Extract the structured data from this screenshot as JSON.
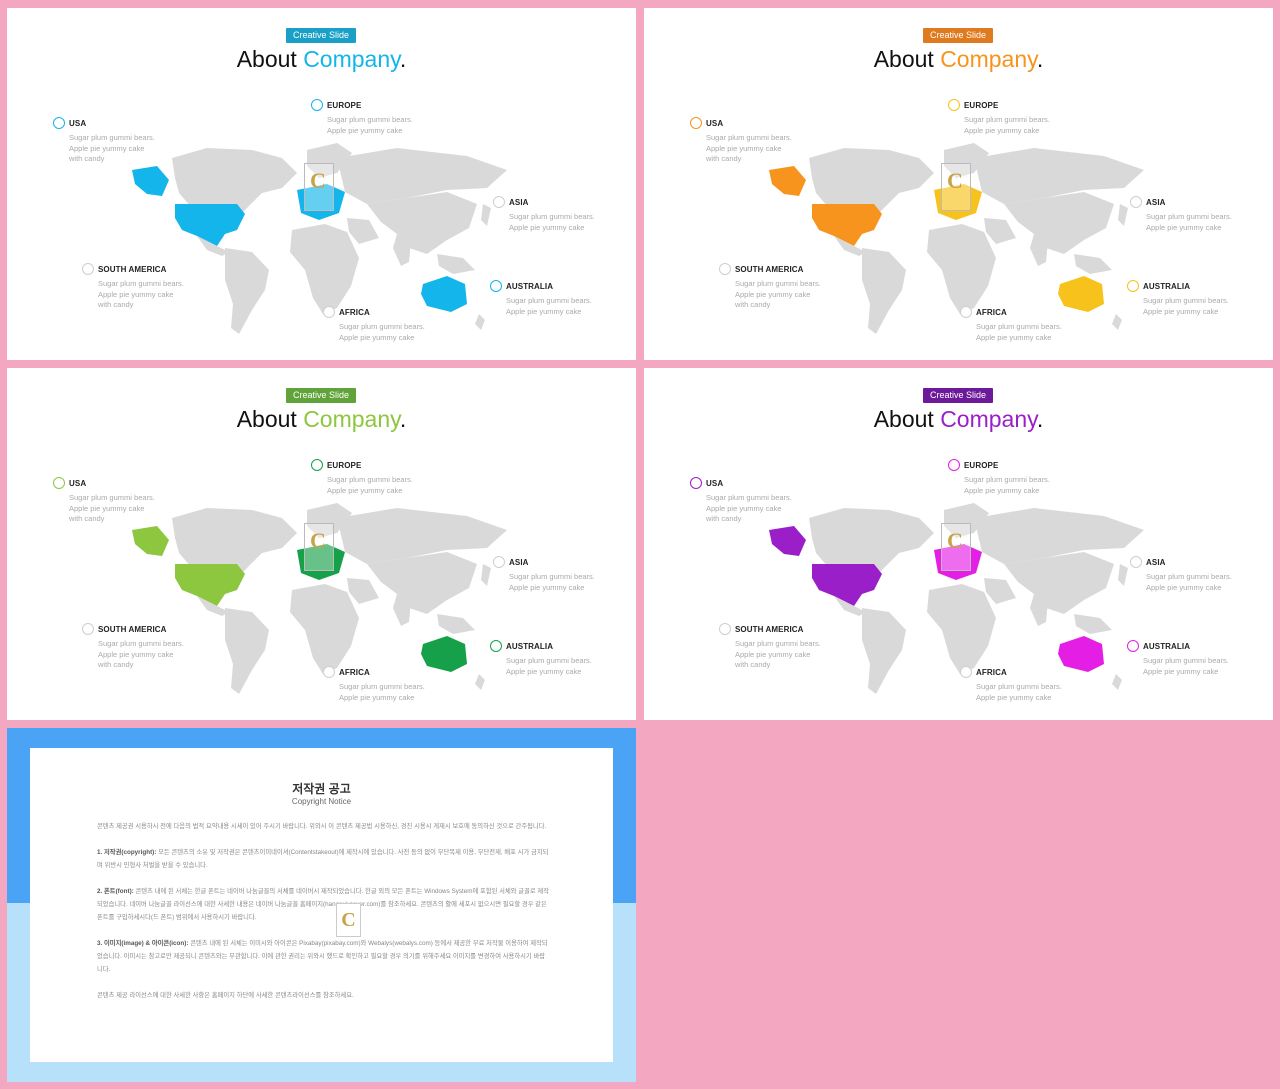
{
  "slides": [
    {
      "badge": "Creative Slide",
      "title_main": "About ",
      "title_accent": "Company",
      "title_end": ".",
      "accent": "#13b5ea",
      "badge_color": "#1aa0c6"
    },
    {
      "badge": "Creative Slide",
      "title_main": "About ",
      "title_accent": "Company",
      "title_end": ".",
      "accent": "#f7941d",
      "badge_color": "#e07a1f",
      "accent2": "#f7c21c"
    },
    {
      "badge": "Creative Slide",
      "title_main": "About ",
      "title_accent": "Company",
      "title_end": ".",
      "accent": "#8dc63f",
      "badge_color": "#5fa33a",
      "accent2": "#16a04a"
    },
    {
      "badge": "Creative Slide",
      "title_main": "About ",
      "title_accent": "Company",
      "title_end": ".",
      "accent": "#9b1fc9",
      "badge_color": "#6d1a9a",
      "accent2": "#e51ee5"
    }
  ],
  "labels": {
    "usa": {
      "name": "USA",
      "lines": [
        "Sugar plum gummi bears.",
        "Apple pie yummy cake",
        "with candy"
      ]
    },
    "europe": {
      "name": "EUROPE",
      "lines": [
        "Sugar plum gummi bears.",
        "Apple pie yummy cake"
      ]
    },
    "asia": {
      "name": "ASIA",
      "lines": [
        "Sugar plum gummi bears.",
        "Apple pie yummy cake"
      ]
    },
    "south_america": {
      "name": "SOUTH AMERICA",
      "lines": [
        "Sugar plum gummi bears.",
        "Apple pie yummy cake",
        "with candy"
      ]
    },
    "australia": {
      "name": "AUSTRALIA",
      "lines": [
        "Sugar plum gummi bears.",
        "Apple pie yummy cake"
      ]
    },
    "africa": {
      "name": "AFRICA",
      "lines": [
        "Sugar plum gummi bears.",
        "Apple pie yummy cake"
      ]
    }
  },
  "copyright": {
    "title": "저작권 공고",
    "subtitle": "Copyright Notice",
    "p0": "콘텐츠 제공권 시용하시 전에 다음의 법적 요약내용 시세이 있어 주시기 바랍니다. 위와시 이 콘텐츠 제공법 시용하신, 경진 시용시 게재시 보호에 동의하신 것으로 간주됩니다.",
    "p1_head": "1. 저작권(copyright): ",
    "p1": "모든 콘텐츠의 소유 및 저작권은 콘텐츠이미네이셔(Contentstakeout)에 제작시에 있습니다. 사전 동의 없이 무단복제 이용, 무단전재, 배포 시가 금지되며 위반시 민형사 처벌을 받을 수 있습니다.",
    "p2_head": "2. 폰트(font): ",
    "p2": "콘텐츠 내에 된 서체는 한글 폰트는 네이버 나눔글꼴의 서체를 네이버시 제작되었습니다. 한글 외의 모든 폰트는 Windows System에 포함된 서체와 글꼴로 제작되었습니다. 네이버 나눔글꼴 라이선스에 대한 사세한 내용은 네이버 나눔글꼴 홈페이지(hangeul.naver.com)를 참조하세요. 콘텐츠의 활에 세포시 없으시면 필요할 경우 같은 폰트를 구입하세시다(드 폰트) 범위에서 사용하시기 바랍니다.",
    "p3_head": "3. 이미지(image) & 아이콘(icon): ",
    "p3": "콘텐츠 내에 된 서체는 이미시와 아이콘은 Pixabay(pixabay.com)와 Webalys(webalys.com) 등에서 제공한 무료 저작물 이용하여 제작되었습니다. 이미시는 참고로만 제공되니 콘텐츠와는 무관합니다. 이에 관한 권리는 위와시 했드로 확인하고 필요할 경우 의기를 위해주세요 이미지를 변경하여 사용하시기 바랍니다.",
    "p4": "콘텐츠 제공 라이선스에 대한 사세한 사항은 홈페이지 하단에 사세한 콘텐츠라이선스를 참조하세요."
  }
}
